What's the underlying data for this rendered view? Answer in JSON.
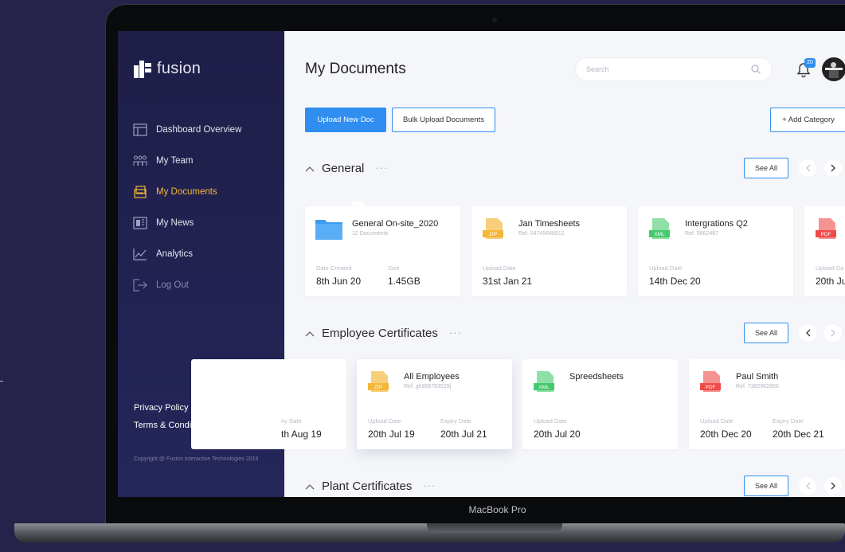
{
  "device": {
    "label": "MacBook Pro"
  },
  "brand": {
    "name": "fusion"
  },
  "sidebar": {
    "items": [
      {
        "label": "Dashboard Overview",
        "icon": "dashboard-icon",
        "state": "normal"
      },
      {
        "label": "My Team",
        "icon": "team-icon",
        "state": "normal"
      },
      {
        "label": "My Documents",
        "icon": "documents-icon",
        "state": "active"
      },
      {
        "label": "My News",
        "icon": "news-icon",
        "state": "normal"
      },
      {
        "label": "Analytics",
        "icon": "analytics-icon",
        "state": "normal"
      },
      {
        "label": "Log Out",
        "icon": "logout-icon",
        "state": "muted"
      }
    ],
    "links": {
      "privacy": "Privacy Policy",
      "terms": "Terms & Conditions"
    },
    "copyright": "Copyright @ Fusion Interactive Technologies 2019"
  },
  "header": {
    "title": "My Documents",
    "search_placeholder": "Search",
    "notification_count": "20"
  },
  "toolbar": {
    "upload_label": "Upload New Doc",
    "bulk_label": "Bulk Upload Documents",
    "add_category_label": "+ Add Category"
  },
  "colors": {
    "accent": "#2f8ef0",
    "active_nav": "#f4b73b",
    "zip": "#f4b73b",
    "xml": "#45c96e",
    "pdf": "#ef4a4a",
    "folder": "#3d9cf0"
  },
  "sections": [
    {
      "title": "General",
      "see_all": "See All",
      "cards": [
        {
          "type": "folder",
          "title": "General On-site_2020",
          "sub": "12 Documents",
          "meta": [
            {
              "label": "Date Created",
              "value": "8th Jun 20"
            },
            {
              "label": "Size",
              "value": "1.45GB"
            }
          ]
        },
        {
          "type": "ZIP",
          "title": "Jan Timesheets",
          "sub": "Ref. 04745648912",
          "meta": [
            {
              "label": "Upload Date",
              "value": "31st Jan 21"
            }
          ]
        },
        {
          "type": "XML",
          "title": "Intergrations Q2",
          "sub": "Ref. 9862467",
          "meta": [
            {
              "label": "Upload Date",
              "value": "14th Dec 20"
            }
          ]
        },
        {
          "type": "PDF",
          "title": "",
          "sub": "",
          "meta": [
            {
              "label": "Upload Da",
              "value": "20th Ju"
            }
          ]
        }
      ]
    },
    {
      "title": "Employee Certificates",
      "see_all": "See All",
      "cards": [
        {
          "type": "none",
          "title": "",
          "sub": "",
          "meta": [
            {
              "label": "iry Date",
              "value": "th Aug 19"
            }
          ]
        },
        {
          "type": "ZIP",
          "title": "All Employees",
          "sub": "Ref. gh856763529j",
          "meta": [
            {
              "label": "Upload Date",
              "value": "20th Jul 19"
            },
            {
              "label": "Expiry Date",
              "value": "20th Jul 21"
            }
          ]
        },
        {
          "type": "XML",
          "title": "Spreedsheets",
          "sub": "",
          "meta": [
            {
              "label": "Upload Date",
              "value": "20th Jul 20"
            }
          ]
        },
        {
          "type": "PDF",
          "title": "Paul Smith",
          "sub": "Ref. 7382962850",
          "meta": [
            {
              "label": "Upload Date",
              "value": "20th Dec 20"
            },
            {
              "label": "Expiry Date",
              "value": "20th Dec 21"
            }
          ]
        }
      ]
    },
    {
      "title": "Plant Certificates",
      "see_all": "See All"
    }
  ]
}
